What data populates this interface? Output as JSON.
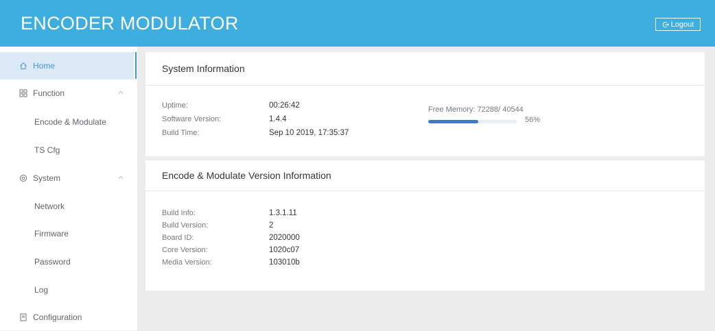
{
  "app": {
    "title": "ENCODER MODULATOR",
    "logout_label": "Logout"
  },
  "sidebar": {
    "items": [
      {
        "label": "Home",
        "icon": "home-icon",
        "active": true
      },
      {
        "label": "Function",
        "icon": "grid-icon"
      },
      {
        "label": "Encode & Modulate"
      },
      {
        "label": "TS Cfg"
      },
      {
        "label": "System",
        "icon": "settings-icon"
      },
      {
        "label": "Network"
      },
      {
        "label": "Firmware"
      },
      {
        "label": "Password"
      },
      {
        "label": "Log"
      },
      {
        "label": "Configuration",
        "icon": "document-icon"
      }
    ]
  },
  "system_info": {
    "title": "System Information",
    "uptime_label": "Uptime:",
    "uptime_value": "00:26:42",
    "software_version_label": "Software Version:",
    "software_version_value": "1.4.4",
    "build_time_label": "Build Time:",
    "build_time_value": "Sep 10 2019, 17:35:37",
    "free_memory_text": "Free Memory: 72288/ 40544",
    "memory_percent": 56,
    "memory_percent_text": "56%"
  },
  "version_info": {
    "title": "Encode & Modulate Version Information",
    "rows": [
      {
        "label": "Build Info:",
        "value": "1.3.1.11"
      },
      {
        "label": "Build Version:",
        "value": "2"
      },
      {
        "label": "Board ID:",
        "value": "2020000"
      },
      {
        "label": "Core Version:",
        "value": "1020c07"
      },
      {
        "label": "Media Version:",
        "value": "103010b"
      }
    ]
  },
  "colors": {
    "header": "#3eaede",
    "accent": "#3e97d3",
    "progress": "#3e7bc4",
    "background": "#ececec"
  }
}
